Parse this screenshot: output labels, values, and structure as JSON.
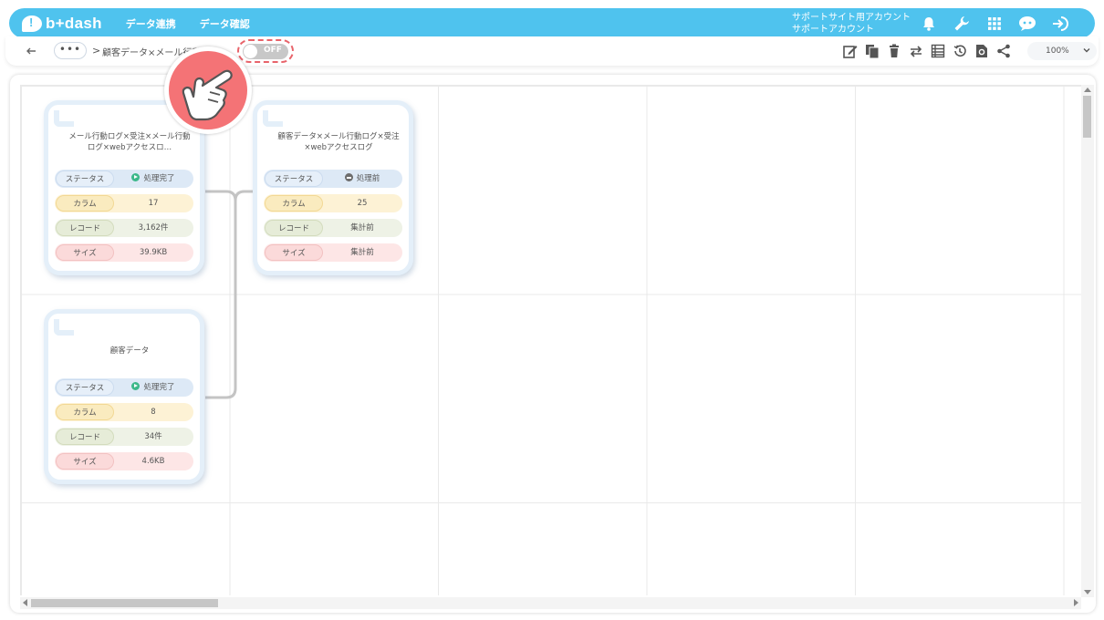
{
  "header": {
    "logo_text": "b+dash",
    "nav": [
      "データ連携",
      "データ確認"
    ],
    "account_line1": "サポートサイト用アカウント",
    "account_line2": "サポートアカウント",
    "icons": [
      "bell-icon",
      "wrench-icon",
      "apps-grid-icon",
      "chat-bot-icon",
      "logout-icon"
    ],
    "brand_color": "#4fc3ee"
  },
  "toolbar": {
    "more_label": "•••",
    "separator": ">",
    "breadcrumb": "顧客データ×メール行動ログ×受注×webアクセスログ",
    "toggle_label": "OFF",
    "zoom": "100%",
    "icons": [
      "edit-icon",
      "copy-icon",
      "trash-icon",
      "swap-icon",
      "table-icon",
      "history-icon",
      "download-icon",
      "share-icon"
    ]
  },
  "cards": [
    {
      "title": "メール行動ログ×受注×メール行動ログ×webアクセスロ…",
      "status_label": "ステータス",
      "status": "処理完了",
      "status_state": "done",
      "column_label": "カラム",
      "columns": "17",
      "record_label": "レコード",
      "records": "3,162件",
      "size_label": "サイズ",
      "size": "39.9KB"
    },
    {
      "title": "顧客データ×メール行動ログ×受注×webアクセスログ",
      "status_label": "ステータス",
      "status": "処理前",
      "status_state": "pending",
      "column_label": "カラム",
      "columns": "25",
      "record_label": "レコード",
      "records": "集計前",
      "size_label": "サイズ",
      "size": "集計前"
    },
    {
      "title": "顧客データ",
      "status_label": "ステータス",
      "status": "処理完了",
      "status_state": "done",
      "column_label": "カラム",
      "columns": "8",
      "record_label": "レコード",
      "records": "34件",
      "size_label": "サイズ",
      "size": "4.6KB"
    }
  ]
}
